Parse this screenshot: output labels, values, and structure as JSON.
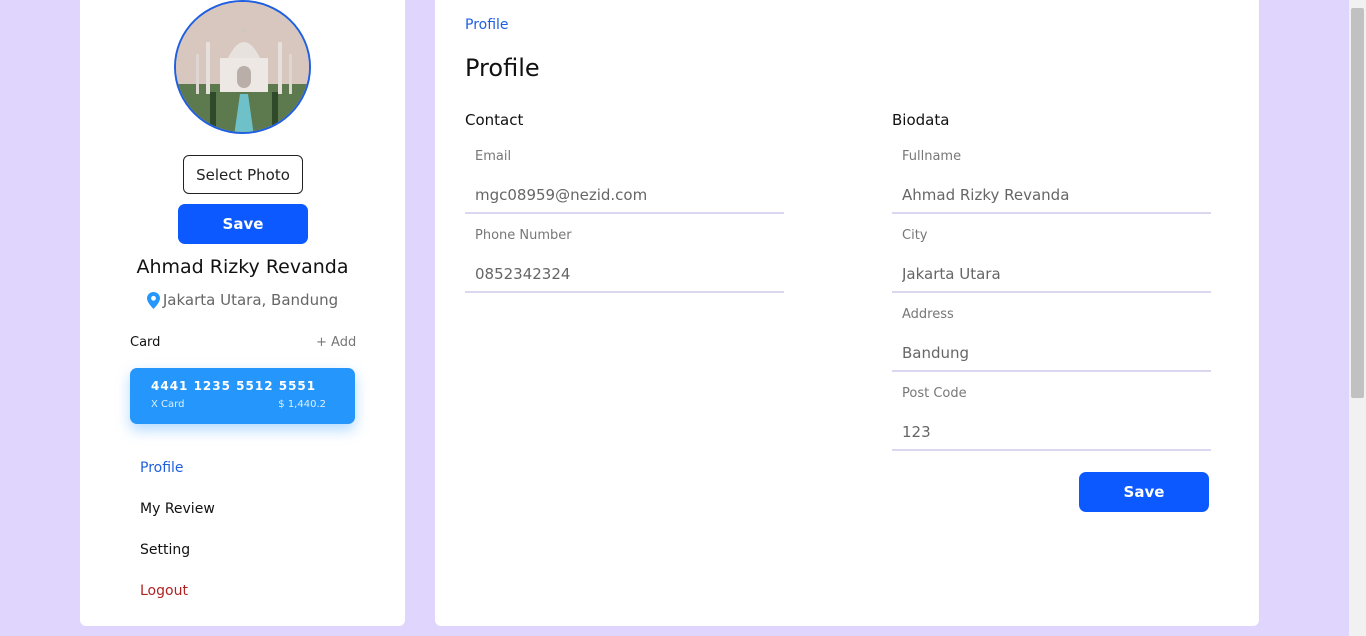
{
  "sidebar": {
    "select_photo_label": "Select Photo",
    "save_label": "Save",
    "user_name": "Ahmad Rizky Revanda",
    "user_location": "Jakarta Utara, Bandung",
    "card_section_label": "Card",
    "card_add_label": "+ Add",
    "card": {
      "number": "4441 1235 5512 5551",
      "type": "X Card",
      "balance": "$ 1,440.2"
    },
    "nav": [
      {
        "label": "Profile",
        "active": true
      },
      {
        "label": "My Review",
        "active": false
      },
      {
        "label": "Setting",
        "active": false
      },
      {
        "label": "Logout",
        "active": false
      }
    ]
  },
  "main": {
    "breadcrumb": "Profile",
    "title": "Profile",
    "contact": {
      "title": "Contact",
      "email_label": "Email",
      "email_value": "mgc08959@nezid.com",
      "phone_label": "Phone Number",
      "phone_value": "0852342324"
    },
    "biodata": {
      "title": "Biodata",
      "fullname_label": "Fullname",
      "fullname_value": "Ahmad Rizky Revanda",
      "city_label": "City",
      "city_value": "Jakarta Utara",
      "address_label": "Address",
      "address_value": "Bandung",
      "postcode_label": "Post Code",
      "postcode_value": "123"
    },
    "save_label": "Save"
  },
  "colors": {
    "background": "#e0d5fc",
    "primary": "#0b59ff",
    "card": "#2596fb",
    "active_nav": "#1f5fe0",
    "logout": "#b22222"
  },
  "icons": {
    "location": "location-pin-icon"
  }
}
